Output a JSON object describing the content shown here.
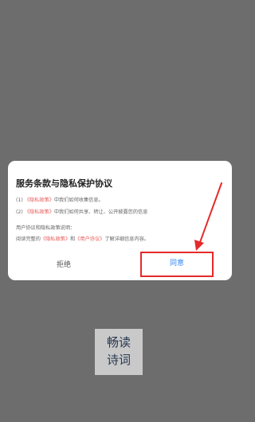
{
  "dialog": {
    "title": "服务条款与隐私保护协议",
    "item1_prefix": "(1) ",
    "item1_link": "《隐私政策》",
    "item1_text": "中我们如何收集信息。",
    "item2_prefix": "(2) ",
    "item2_link": "《隐私政策》",
    "item2_text": "中我们如何共享、转让、公开披露您的信息",
    "note": "用户协议和隐私政策说明：",
    "read_prefix": "阅读完整的",
    "read_link1": "《隐私政策》",
    "read_and": "和",
    "read_link2": "《用户协议》",
    "read_suffix": "了解详细信息内容。",
    "reject_label": "拒绝",
    "agree_label": "同意"
  },
  "logo": {
    "line1": "畅读",
    "line2": "诗词"
  },
  "colors": {
    "overlay": "#6d6d6d",
    "link": "#e85c5c",
    "agree": "#2f86f6",
    "annotation": "#e52a2a"
  }
}
